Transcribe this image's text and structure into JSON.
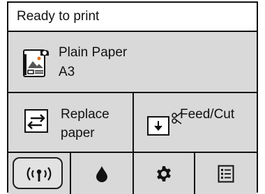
{
  "status": {
    "text": "Ready to print"
  },
  "paper": {
    "type": "Plain Paper",
    "size": "A3",
    "icon": "paper-roll-icon"
  },
  "actions": {
    "replace": {
      "line1": "Replace",
      "line2": "paper",
      "icon": "replace-paper-icon"
    },
    "feed": {
      "label": "Feed/Cut",
      "icon": "feed-cut-icon"
    }
  },
  "tabs": [
    {
      "name": "wireless",
      "icon": "wireless-icon",
      "selected": true
    },
    {
      "name": "ink",
      "icon": "ink-drop-icon",
      "selected": false
    },
    {
      "name": "settings",
      "icon": "gear-icon",
      "selected": false
    },
    {
      "name": "job-list",
      "icon": "list-icon",
      "selected": false
    }
  ],
  "colors": {
    "panel_bg": "#d9d9d9",
    "status_bg": "#ffffff",
    "border": "#111111",
    "accent_orange": "#e07020"
  }
}
